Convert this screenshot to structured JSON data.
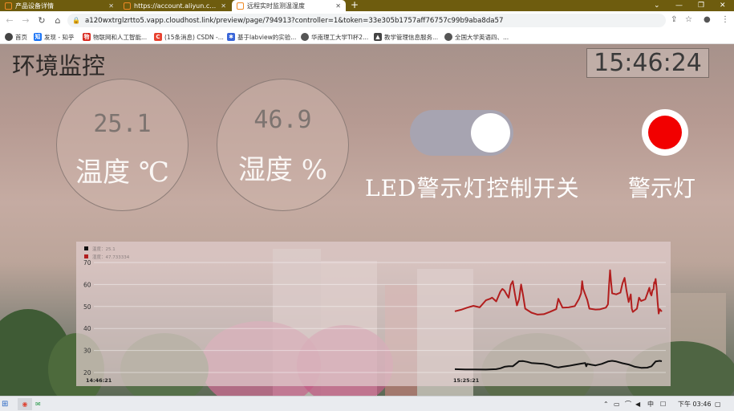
{
  "browser": {
    "tabs": [
      {
        "title": "产品设备详情",
        "active": false
      },
      {
        "title": "https://account.aliyun.com/lo",
        "active": false
      },
      {
        "title": "远程实时监测温湿度",
        "active": true
      }
    ],
    "new_tab": "+",
    "url": "a120wxtrglzrtto5.vapp.cloudhost.link/preview/page/794913?controller=1&token=33e305b1757aff76757c99b9aba8da57",
    "bookmarks": [
      {
        "label": "首页",
        "color": "#444444"
      },
      {
        "label": "发现 - 知乎",
        "color": "#1772f6"
      },
      {
        "label": "物联网和人工智能...",
        "color": "#d8261c"
      },
      {
        "label": "(15条消息) CSDN -...",
        "color": "#e8422f"
      },
      {
        "label": "基于labview的实验...",
        "color": "#3a66d8"
      },
      {
        "label": "华南理工大学TI杯2...",
        "color": "#555555"
      },
      {
        "label": "教学管理信息服务...",
        "color": "#444444"
      },
      {
        "label": "全国大学英语四、...",
        "color": "#555555"
      }
    ]
  },
  "app": {
    "title": "环境监控",
    "clock": "15:46:24",
    "temperature": {
      "value": "25.1",
      "label": "温度 ℃"
    },
    "humidity": {
      "value": "46.9",
      "label": "湿度 %"
    },
    "led_switch": {
      "label": "LED警示灯控制开关",
      "state": "on",
      "color": "#a7a4b1"
    },
    "warning_lamp": {
      "label": "警示灯",
      "state": "on",
      "color": "#f20000"
    }
  },
  "chart_data": {
    "type": "line",
    "legend": [
      {
        "name": "温度：25.1",
        "color": "#111111"
      },
      {
        "name": "湿度：47.733334",
        "color": "#b21e1e"
      }
    ],
    "y_ticks": [
      "70",
      "60",
      "50",
      "40",
      "30",
      "20"
    ],
    "ylim": [
      20,
      70
    ],
    "x_labels": [
      "14:46:21",
      "15:25:21"
    ],
    "series": [
      {
        "name": "湿度",
        "color": "#b21e1e",
        "points": [
          [
            0,
            47.8
          ],
          [
            0.03,
            48.5
          ],
          [
            0.06,
            49.5
          ],
          [
            0.09,
            50.3
          ],
          [
            0.12,
            49.6
          ],
          [
            0.15,
            52.8
          ],
          [
            0.17,
            53.5
          ],
          [
            0.18,
            54.0
          ],
          [
            0.2,
            52.3
          ],
          [
            0.22,
            56.8
          ],
          [
            0.23,
            58.0
          ],
          [
            0.24,
            57.2
          ],
          [
            0.25,
            55.5
          ],
          [
            0.26,
            54.0
          ],
          [
            0.27,
            59.8
          ],
          [
            0.28,
            61.5
          ],
          [
            0.29,
            55.8
          ],
          [
            0.3,
            50.5
          ],
          [
            0.31,
            53.2
          ],
          [
            0.32,
            60.0
          ],
          [
            0.33,
            55.0
          ],
          [
            0.34,
            49.0
          ],
          [
            0.37,
            47.2
          ],
          [
            0.4,
            46.3
          ],
          [
            0.43,
            46.5
          ],
          [
            0.46,
            47.6
          ],
          [
            0.49,
            48.8
          ],
          [
            0.5,
            53.5
          ],
          [
            0.51,
            51.5
          ],
          [
            0.52,
            49.5
          ],
          [
            0.55,
            49.6
          ],
          [
            0.58,
            50.2
          ],
          [
            0.6,
            53.5
          ],
          [
            0.61,
            56.0
          ],
          [
            0.615,
            61.5
          ],
          [
            0.62,
            58.0
          ],
          [
            0.63,
            55.5
          ],
          [
            0.64,
            53.0
          ],
          [
            0.65,
            49.0
          ],
          [
            0.68,
            48.6
          ],
          [
            0.7,
            48.7
          ],
          [
            0.73,
            49.5
          ],
          [
            0.74,
            51.0
          ],
          [
            0.745,
            59.5
          ],
          [
            0.75,
            66.5
          ],
          [
            0.755,
            61.0
          ],
          [
            0.76,
            56.0
          ],
          [
            0.78,
            55.5
          ],
          [
            0.8,
            56.3
          ],
          [
            0.81,
            60.5
          ],
          [
            0.82,
            63.0
          ],
          [
            0.83,
            57.0
          ],
          [
            0.84,
            52.0
          ],
          [
            0.85,
            55.5
          ],
          [
            0.855,
            49.0
          ],
          [
            0.86,
            47.5
          ],
          [
            0.88,
            49.0
          ],
          [
            0.89,
            54.0
          ],
          [
            0.9,
            52.5
          ],
          [
            0.92,
            53.3
          ],
          [
            0.93,
            55.8
          ],
          [
            0.94,
            58.5
          ],
          [
            0.945,
            56.0
          ],
          [
            0.95,
            55.0
          ],
          [
            0.955,
            57.5
          ],
          [
            0.96,
            57.8
          ],
          [
            0.963,
            61.0
          ],
          [
            0.966,
            60.5
          ],
          [
            0.97,
            62.5
          ],
          [
            0.975,
            58.5
          ],
          [
            0.98,
            52.0
          ],
          [
            0.985,
            46.8
          ],
          [
            0.99,
            48.8
          ],
          [
            1.0,
            47.7
          ]
        ]
      },
      {
        "name": "温度",
        "color": "#111111",
        "points": [
          [
            0,
            21.5
          ],
          [
            0.05,
            21.4
          ],
          [
            0.1,
            21.4
          ],
          [
            0.15,
            21.3
          ],
          [
            0.2,
            21.5
          ],
          [
            0.22,
            21.9
          ],
          [
            0.24,
            22.6
          ],
          [
            0.26,
            22.8
          ],
          [
            0.28,
            22.8
          ],
          [
            0.3,
            24.3
          ],
          [
            0.31,
            25.1
          ],
          [
            0.33,
            25.2
          ],
          [
            0.35,
            24.8
          ],
          [
            0.37,
            24.3
          ],
          [
            0.4,
            24.1
          ],
          [
            0.43,
            23.9
          ],
          [
            0.46,
            23.3
          ],
          [
            0.48,
            22.6
          ],
          [
            0.5,
            22.3
          ],
          [
            0.52,
            22.6
          ],
          [
            0.55,
            23.0
          ],
          [
            0.58,
            23.5
          ],
          [
            0.61,
            24.0
          ],
          [
            0.63,
            24.3
          ],
          [
            0.635,
            22.8
          ],
          [
            0.64,
            23.9
          ],
          [
            0.66,
            23.5
          ],
          [
            0.68,
            23.2
          ],
          [
            0.71,
            23.9
          ],
          [
            0.74,
            25.0
          ],
          [
            0.76,
            25.3
          ],
          [
            0.78,
            25.0
          ],
          [
            0.81,
            24.2
          ],
          [
            0.84,
            23.6
          ],
          [
            0.87,
            22.6
          ],
          [
            0.9,
            22.1
          ],
          [
            0.93,
            22.2
          ],
          [
            0.95,
            22.8
          ],
          [
            0.97,
            25.0
          ],
          [
            0.99,
            25.3
          ],
          [
            1.0,
            25.1
          ]
        ]
      }
    ]
  },
  "taskbar": {
    "clock": "下午 03:46",
    "ime": "中"
  }
}
